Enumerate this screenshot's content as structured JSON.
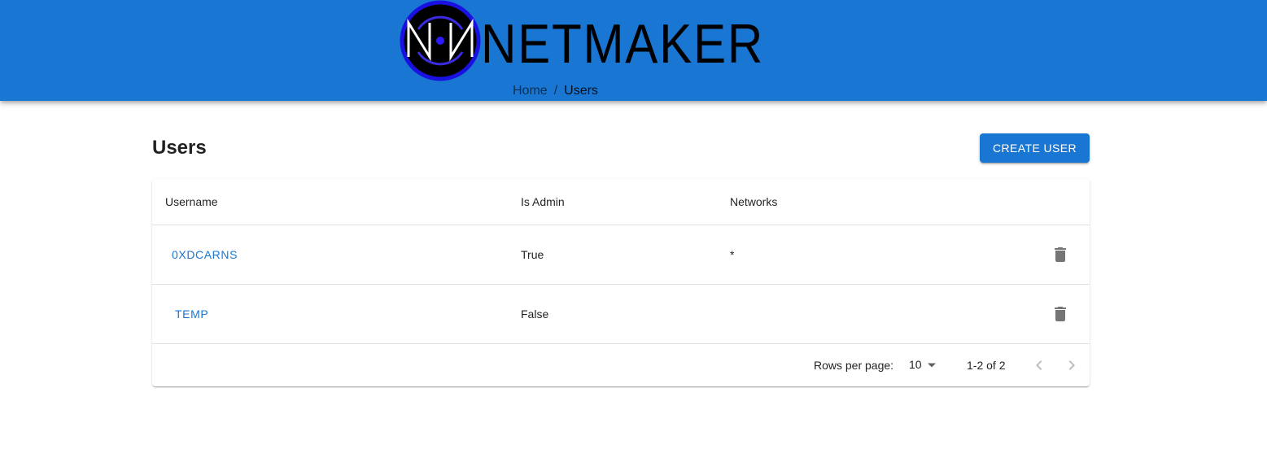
{
  "header": {
    "logo_text": "NETMAKER",
    "breadcrumb": {
      "home": "Home",
      "separator": "/",
      "current": "Users"
    }
  },
  "page": {
    "title": "Users",
    "create_button": "Create User"
  },
  "table": {
    "columns": [
      "Username",
      "Is Admin",
      "Networks"
    ],
    "rows": [
      {
        "username": "0xdcarns",
        "is_admin": "True",
        "networks": "*",
        "action_icon": "delete-icon"
      },
      {
        "username": "temp",
        "is_admin": "False",
        "networks": "",
        "action_icon": "delete-icon"
      }
    ]
  },
  "pagination": {
    "rows_per_page_label": "Rows per page:",
    "rows_per_page_value": "10",
    "range": "1-2 of 2",
    "prev_icon": "chevron-left-icon",
    "next_icon": "chevron-right-icon"
  },
  "colors": {
    "primary": "#1976d2",
    "logo_ring": "#1a10e0",
    "icon_grey": "#757575"
  }
}
